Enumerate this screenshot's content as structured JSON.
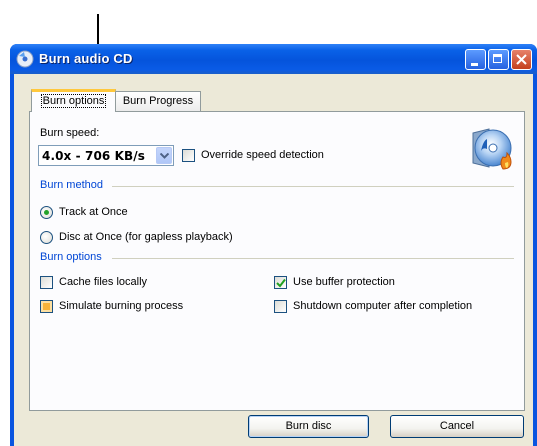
{
  "window": {
    "title": "Burn audio CD"
  },
  "tabs": [
    {
      "label": "Burn options",
      "selected": true
    },
    {
      "label": "Burn Progress",
      "selected": false
    }
  ],
  "burn_speed": {
    "label": "Burn speed:",
    "selected_value": "4.0x - 706 KB/s",
    "override_label": "Override speed detection",
    "override_checked": false
  },
  "burn_method": {
    "group_label": "Burn method",
    "options": [
      {
        "label": "Track at Once",
        "selected": true
      },
      {
        "label": "Disc at Once (for gapless playback)",
        "selected": false
      }
    ]
  },
  "burn_options": {
    "group_label": "Burn options",
    "cache_files": {
      "label": "Cache files locally",
      "checked": false
    },
    "simulate": {
      "label": "Simulate burning process",
      "checked": false
    },
    "buffer_protection": {
      "label": "Use buffer protection",
      "checked": true
    },
    "shutdown": {
      "label": "Shutdown computer after completion",
      "checked": false
    }
  },
  "buttons": {
    "burn": "Burn disc",
    "cancel": "Cancel"
  },
  "icons": {
    "app": "cd-burn-icon",
    "header": "music-cd-burn-icon"
  }
}
